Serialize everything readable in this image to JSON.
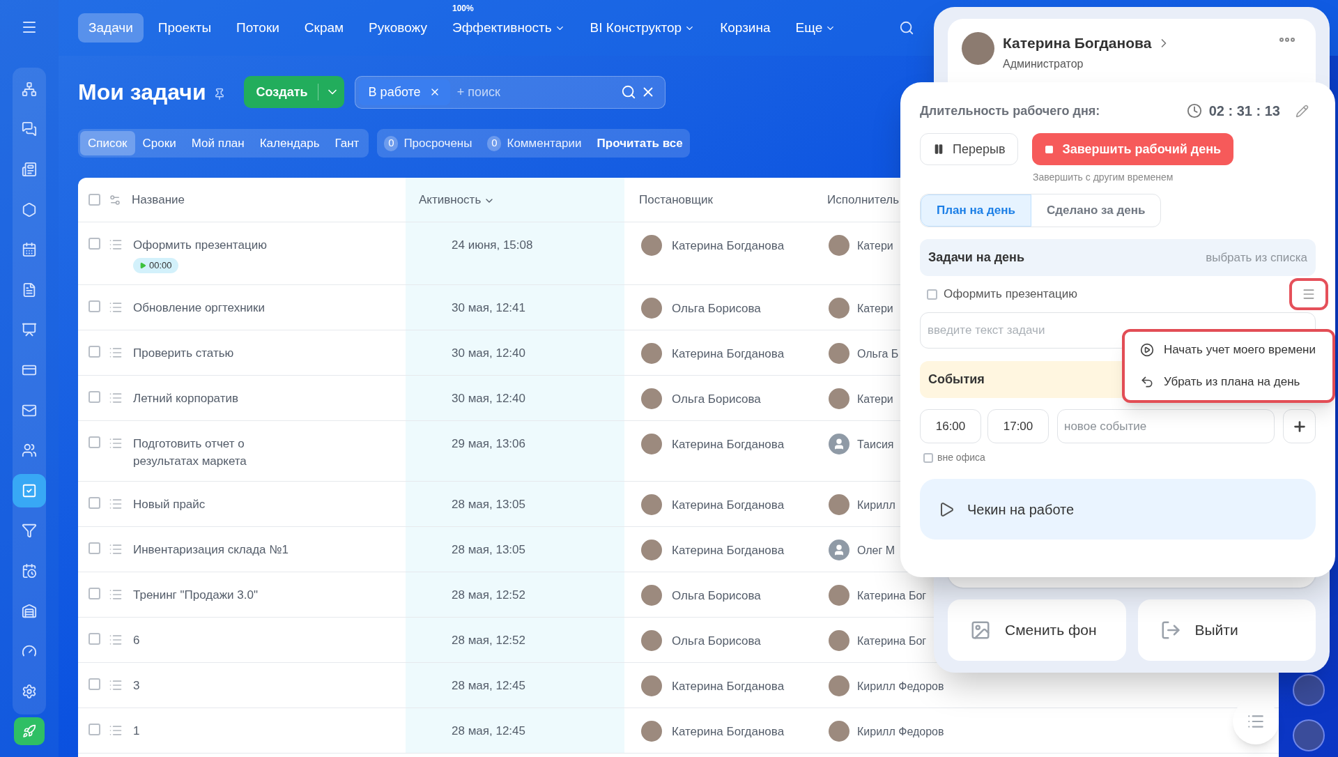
{
  "sidebar": {
    "items": [
      {
        "selected": false
      },
      {
        "selected": false
      },
      {
        "selected": false
      },
      {
        "selected": false
      },
      {
        "selected": false
      },
      {
        "selected": false
      },
      {
        "selected": false
      },
      {
        "selected": false
      },
      {
        "selected": false
      },
      {
        "selected": false
      },
      {
        "selected": true
      },
      {
        "selected": false
      },
      {
        "selected": false
      },
      {
        "selected": false
      },
      {
        "selected": false
      },
      {
        "selected": false
      }
    ]
  },
  "top_nav": {
    "items": [
      {
        "label": "Задачи",
        "selected": true,
        "dropdown": false
      },
      {
        "label": "Проекты",
        "selected": false,
        "dropdown": false
      },
      {
        "label": "Потоки",
        "selected": false,
        "dropdown": false
      },
      {
        "label": "Скрам",
        "selected": false,
        "dropdown": false
      },
      {
        "label": "Руковожу",
        "selected": false,
        "dropdown": false
      },
      {
        "label": "Эффективность",
        "badge": "100%",
        "selected": false,
        "dropdown": true
      },
      {
        "label": "BI Конструктор",
        "selected": false,
        "dropdown": true
      },
      {
        "label": "Корзина",
        "selected": false,
        "dropdown": false
      },
      {
        "label": "Еще",
        "selected": false,
        "dropdown": true
      }
    ]
  },
  "page_title": "Мои задачи",
  "create_button": "Создать",
  "filter": {
    "chip": "В работе",
    "placeholder": "+ поиск"
  },
  "views": [
    {
      "label": "Список",
      "selected": true
    },
    {
      "label": "Сроки",
      "selected": false
    },
    {
      "label": "Мой план",
      "selected": false
    },
    {
      "label": "Календарь",
      "selected": false
    },
    {
      "label": "Гант",
      "selected": false
    }
  ],
  "counters": [
    {
      "count": "0",
      "label": "Просрочены"
    },
    {
      "count": "0",
      "label": "Комментарии"
    }
  ],
  "read_all": "Прочитать все",
  "table": {
    "select_all_checked": false,
    "columns": [
      "Название",
      "Активность",
      "Постановщик",
      "Исполнитель"
    ],
    "rows": [
      {
        "checked": false,
        "title": "Оформить презентацию",
        "timer": "00:00",
        "activity": "24 июня, 15:08",
        "creator": {
          "name": "Катерина Богданова",
          "kind": "photo"
        },
        "assignee": {
          "name": "Катери",
          "kind": "photo"
        }
      },
      {
        "checked": false,
        "title": "Обновление оргтехники",
        "activity": "30 мая, 12:41",
        "creator": {
          "name": "Ольга Борисова",
          "kind": "photo"
        },
        "assignee": {
          "name": "Катери",
          "kind": "photo"
        }
      },
      {
        "checked": false,
        "title": "Проверить статью",
        "activity": "30 мая, 12:40",
        "creator": {
          "name": "Катерина Богданова",
          "kind": "photo"
        },
        "assignee": {
          "name": "Ольга Б",
          "kind": "photo"
        }
      },
      {
        "checked": false,
        "title": "Летний корпоратив",
        "activity": "30 мая, 12:40",
        "creator": {
          "name": "Ольга Борисова",
          "kind": "photo"
        },
        "assignee": {
          "name": "Катери",
          "kind": "photo"
        }
      },
      {
        "checked": false,
        "title": "Подготовить отчет о\nрезультатах маркета",
        "activity": "29 мая, 13:06",
        "creator": {
          "name": "Катерина Богданова",
          "kind": "photo"
        },
        "assignee": {
          "name": "Таисия",
          "kind": "default"
        }
      },
      {
        "checked": false,
        "title": "Новый прайс",
        "activity": "28 мая, 13:05",
        "creator": {
          "name": "Катерина Богданова",
          "kind": "photo"
        },
        "assignee": {
          "name": "Кирилл",
          "kind": "photo"
        }
      },
      {
        "checked": false,
        "title": "Инвентаризация склада №1",
        "activity": "28 мая, 13:05",
        "creator": {
          "name": "Катерина Богданова",
          "kind": "photo"
        },
        "assignee": {
          "name": "Олег М",
          "kind": "default"
        }
      },
      {
        "checked": false,
        "title": "Тренинг \"Продажи 3.0\"",
        "activity": "28 мая, 12:52",
        "creator": {
          "name": "Ольга Борисова",
          "kind": "photo"
        },
        "assignee": {
          "name": "Катерина Бог",
          "kind": "photo"
        }
      },
      {
        "checked": false,
        "title": "6",
        "activity": "28 мая, 12:52",
        "creator": {
          "name": "Ольга Борисова",
          "kind": "photo"
        },
        "assignee": {
          "name": "Катерина Бог",
          "kind": "photo"
        }
      },
      {
        "checked": false,
        "title": "3",
        "activity": "28 мая, 12:45",
        "creator": {
          "name": "Катерина Богданова",
          "kind": "photo"
        },
        "assignee": {
          "name": "Кирилл Федоров",
          "kind": "photo"
        }
      },
      {
        "checked": false,
        "title": "1",
        "activity": "28 мая, 12:45",
        "creator": {
          "name": "Катерина Богданова",
          "kind": "photo"
        },
        "assignee": {
          "name": "Кирилл Федоров",
          "kind": "photo"
        }
      }
    ]
  },
  "profile": {
    "name": "Катерина Богданова",
    "role": "Администратор"
  },
  "profile_actions": [
    {
      "kind": "background",
      "label": "Сменить фон"
    },
    {
      "kind": "logout",
      "label": "Выйти"
    }
  ],
  "work_day": {
    "title": "Длительность рабочего дня:",
    "time": "02 : 31 : 13",
    "pause_button": "Перерыв",
    "finish_button": "Завершить рабочий день",
    "finish_other_time": "Завершить с другим временем",
    "tabs": [
      {
        "label": "План на день",
        "selected": true
      },
      {
        "label": "Сделано за день",
        "selected": false
      }
    ],
    "tasks_header": "Задачи на день",
    "pick_from_list": "выбрать из списка",
    "tasks": [
      {
        "title": "Оформить презентацию",
        "checked": false
      }
    ],
    "task_input_placeholder": "введите текст задачи",
    "events_header": "События",
    "event_start": "16:00",
    "event_end": "17:00",
    "event_placeholder": "новое событие",
    "out_of_office": {
      "label": "вне офиса",
      "checked": false
    },
    "checkin": "Чекин на работе"
  },
  "task_menu": [
    {
      "kind": "start",
      "label": "Начать учет моего времени"
    },
    {
      "kind": "remove",
      "label": "Убрать из плана на день"
    }
  ]
}
